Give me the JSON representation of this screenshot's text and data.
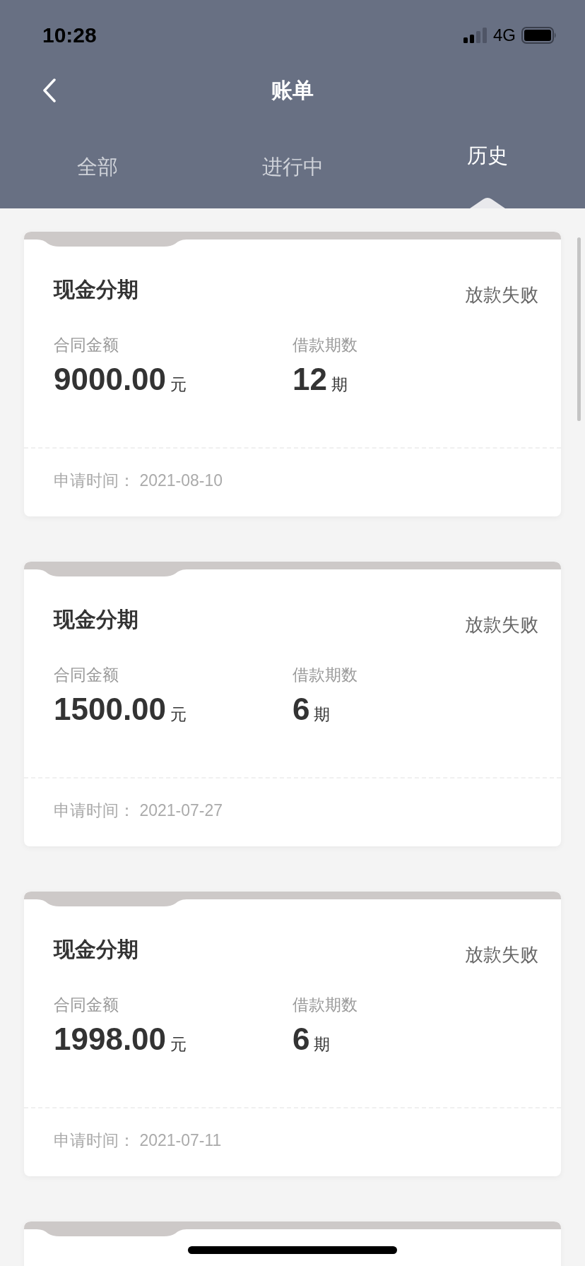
{
  "status_bar": {
    "time": "10:28",
    "network": "4G"
  },
  "nav": {
    "title": "账单"
  },
  "tabs": [
    {
      "label": "全部",
      "selected": false
    },
    {
      "label": "进行中",
      "selected": false
    },
    {
      "label": "历史",
      "selected": true
    }
  ],
  "bills": [
    {
      "title": "现金分期",
      "status": "放款失败",
      "amount_label": "合同金额",
      "amount": "9000.00",
      "amount_unit": "元",
      "term_label": "借款期数",
      "term": "12",
      "term_unit": "期",
      "date_label": "申请时间：",
      "date": "2021-08-10"
    },
    {
      "title": "现金分期",
      "status": "放款失败",
      "amount_label": "合同金额",
      "amount": "1500.00",
      "amount_unit": "元",
      "term_label": "借款期数",
      "term": "6",
      "term_unit": "期",
      "date_label": "申请时间：",
      "date": "2021-07-27"
    },
    {
      "title": "现金分期",
      "status": "放款失败",
      "amount_label": "合同金额",
      "amount": "1998.00",
      "amount_unit": "元",
      "term_label": "借款期数",
      "term": "6",
      "term_unit": "期",
      "date_label": "申请时间：",
      "date": "2021-07-11"
    }
  ]
}
